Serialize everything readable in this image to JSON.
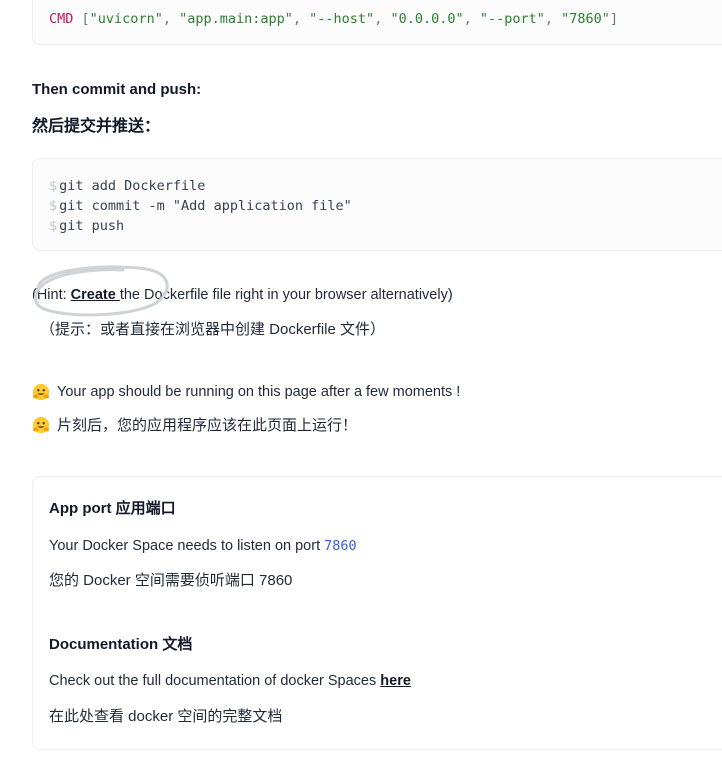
{
  "dockerfile_tail": {
    "keyword": "CMD",
    "args": [
      "\"uvicorn\"",
      "\"app.main:app\"",
      "\"--host\"",
      "\"0.0.0.0\"",
      "\"--port\"",
      "\"7860\""
    ]
  },
  "commit_heading": {
    "en": "Then commit and push:",
    "zh": "然后提交并推送："
  },
  "git_commands": {
    "prompt": "$",
    "lines": [
      "git add Dockerfile",
      "git commit -m \"Add application file\"",
      "git push"
    ]
  },
  "hint": {
    "prefix": "(Hint: ",
    "link": "Create ",
    "suffix": "the Dockerfile file right in your browser alternatively)",
    "zh": "（提示：或者直接在浏览器中创建 Dockerfile 文件）"
  },
  "running": {
    "en": "Your app should be running on this page after a few moments !",
    "zh": "片刻后，您的应用程序应该在此页面上运行！"
  },
  "app_port": {
    "title": "App port 应用端口",
    "text_en": "Your Docker Space needs to listen on port",
    "port": "7860",
    "text_zh": "您的 Docker 空间需要侦听端口 7860"
  },
  "documentation": {
    "title": "Documentation 文档",
    "text_en": "Check out the full documentation of docker Spaces",
    "link": "here",
    "text_zh": "在此处查看 docker 空间的完整文档"
  }
}
